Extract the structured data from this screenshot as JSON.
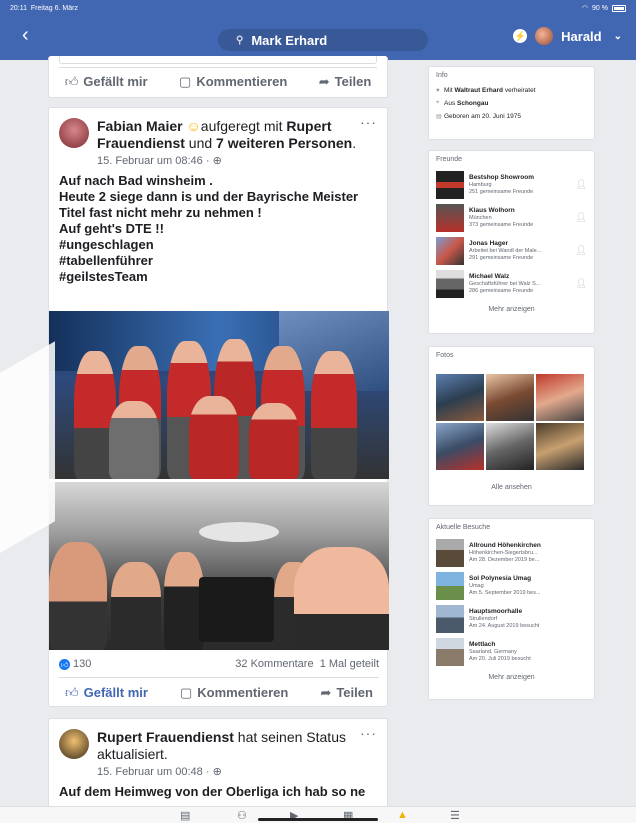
{
  "status": {
    "time": "20:11",
    "date": "Freitag 6. März",
    "battery": "90 %"
  },
  "nav": {
    "search": "Mark Erhard",
    "user": "Harald"
  },
  "actions": {
    "like": "Gefällt mir",
    "comment": "Kommentieren",
    "share": "Teilen"
  },
  "post1": {
    "author": "Fabian Maier",
    "feeling": "aufgeregt mit",
    "with": "Rupert Frauendienst",
    "and": "und",
    "others": "7 weiteren Personen",
    "date": "15. Februar um 08:46 ·",
    "lines": [
      "Auf nach Bad winsheim .",
      "Heute 2 siege dann is und der Bayrische Meister",
      "Titel fast nicht mehr zu nehmen !",
      "Auf geht's DTE !!",
      "#ungeschlagen",
      "#tabellenführer",
      "#geilstesTeam"
    ],
    "reactions": "130",
    "comments": "32 Kommentare",
    "shares": "1 Mal geteilt"
  },
  "post2": {
    "author": "Rupert Frauendienst",
    "action": "hat seinen Status aktualisiert.",
    "date": "15. Februar um 00:48 ·",
    "line": "Auf dem Heimweg von der Oberliga ich hab so ne"
  },
  "info": {
    "title": "Info",
    "married_prefix": "Mit",
    "married_name": "Waltraut Erhard",
    "married_suffix": "verheiratet",
    "from_prefix": "Aus",
    "from_place": "Schongau",
    "born": "Geboren am 20. Juni 1975"
  },
  "friends": {
    "title": "Freunde",
    "items": [
      {
        "name": "Bestshop Showroom",
        "sub1": "Hamburg",
        "sub2": "251 gemeinsame Freunde"
      },
      {
        "name": "Klaus Wolhorn",
        "sub1": "München",
        "sub2": "373 gemeinsame Freunde"
      },
      {
        "name": "Jonas Hager",
        "sub1": "Arbeitet bei Wandl der Male...",
        "sub2": "291 gemeinsame Freunde"
      },
      {
        "name": "Michael Walz",
        "sub1": "Geschäftsführer bei Walz S...",
        "sub2": "286 gemeinsame Freunde"
      }
    ],
    "more": "Mehr anzeigen"
  },
  "photos": {
    "title": "Fotos",
    "more": "Alle ansehen"
  },
  "visits": {
    "title": "Aktuelle Besuche",
    "items": [
      {
        "name": "Allround Höhenkirchen",
        "sub1": "Höhenkirchen-Siegertsbru...",
        "sub2": "Am 28. Dezember 2019 be..."
      },
      {
        "name": "Sol Polynesia Umag",
        "sub1": "Umag",
        "sub2": "Am 5. September 2019 bes..."
      },
      {
        "name": "Hauptsmoorhalle",
        "sub1": "Strullendorf",
        "sub2": "Am 24. August 2019 besucht"
      },
      {
        "name": "Mettlach",
        "sub1": "Saarland, Germany",
        "sub2": "Am 20. Juli 2019 besucht"
      }
    ],
    "more": "Mehr anzeigen"
  }
}
